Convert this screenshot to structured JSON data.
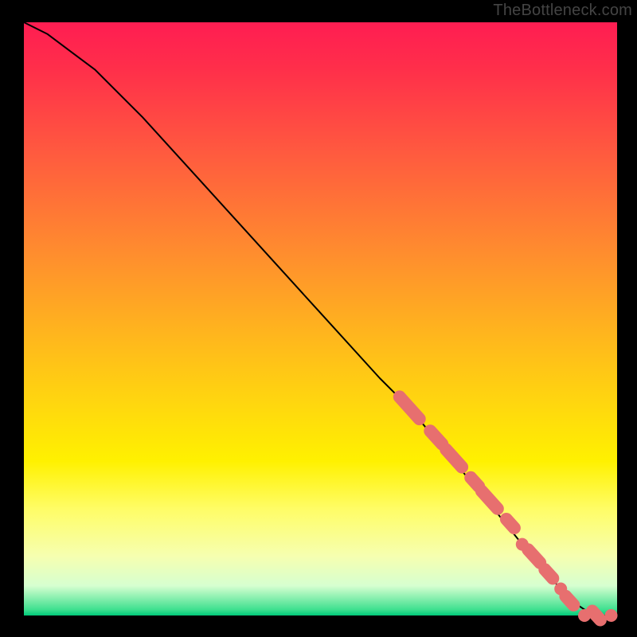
{
  "watermark": "TheBottleneck.com",
  "colors": {
    "marker": "#e76f6f",
    "curve": "#000000",
    "frame": "#000000"
  },
  "chart_data": {
    "type": "line",
    "title": "",
    "xlabel": "",
    "ylabel": "",
    "xlim": [
      0,
      100
    ],
    "ylim": [
      0,
      100
    ],
    "grid": false,
    "legend": false,
    "series": [
      {
        "name": "bottleneck-curve",
        "x": [
          0,
          4,
          8,
          12,
          20,
          30,
          40,
          50,
          60,
          65,
          70,
          75,
          80,
          84,
          87,
          90,
          93,
          96,
          98,
          100
        ],
        "y": [
          100,
          98,
          95,
          92,
          84,
          73,
          62,
          51,
          40,
          35,
          29,
          23,
          17,
          12,
          9,
          5,
          2,
          0,
          0,
          0
        ]
      }
    ],
    "markers": {
      "comment": "salmon lozenge/dot overlays along lower-right portion of curve (x,y in same 0–100 space); len = approximate run-length for elongated lozenges, 0 = round dot",
      "points": [
        {
          "x": 65.0,
          "y": 35.0,
          "len": 5
        },
        {
          "x": 69.5,
          "y": 30.0,
          "len": 3
        },
        {
          "x": 72.5,
          "y": 26.5,
          "len": 4
        },
        {
          "x": 76.0,
          "y": 22.5,
          "len": 2
        },
        {
          "x": 78.5,
          "y": 19.5,
          "len": 4
        },
        {
          "x": 82.0,
          "y": 15.5,
          "len": 2
        },
        {
          "x": 84.0,
          "y": 12.0,
          "len": 0
        },
        {
          "x": 86.0,
          "y": 10.0,
          "len": 3
        },
        {
          "x": 88.5,
          "y": 7.0,
          "len": 2
        },
        {
          "x": 90.5,
          "y": 4.5,
          "len": 0
        },
        {
          "x": 92.0,
          "y": 2.5,
          "len": 2
        },
        {
          "x": 94.5,
          "y": 0.0,
          "len": 0
        },
        {
          "x": 96.5,
          "y": 0.0,
          "len": 2
        },
        {
          "x": 99.0,
          "y": 0.0,
          "len": 0
        }
      ]
    }
  }
}
